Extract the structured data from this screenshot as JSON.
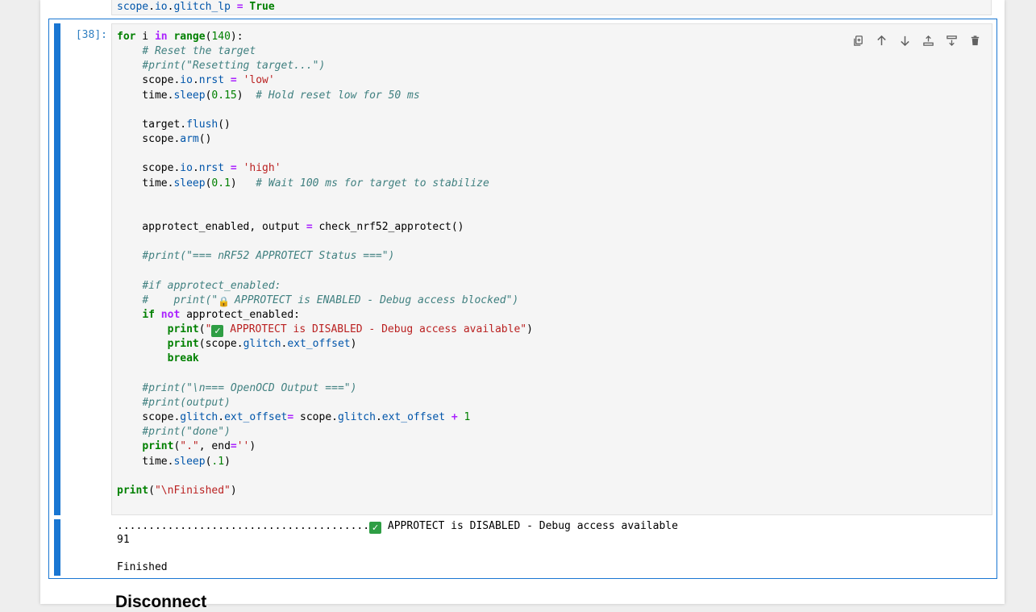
{
  "prev_cell": {
    "code_line": "scope.io.glitch_lp = True"
  },
  "cell": {
    "prompt": "[38]:",
    "toolbar": [
      {
        "name": "duplicate-icon",
        "label": "Duplicate cell"
      },
      {
        "name": "arrow-up-icon",
        "label": "Move cell up"
      },
      {
        "name": "arrow-down-icon",
        "label": "Move cell down"
      },
      {
        "name": "insert-above-icon",
        "label": "Insert cell above"
      },
      {
        "name": "insert-below-icon",
        "label": "Insert cell below"
      },
      {
        "name": "trash-icon",
        "label": "Delete cell"
      }
    ],
    "output_lines": [
      "........................................",
      "91",
      "",
      "Finished"
    ],
    "output_check_text": " APPROTECT is DISABLED - Debug access available"
  },
  "next_heading": "Disconnect",
  "colors": {
    "accent": "#1976d2",
    "prompt": "#307fc1",
    "editor_bg": "#f5f5f5",
    "keyword": "#008000",
    "string": "#ba2121",
    "comment": "#408080"
  }
}
